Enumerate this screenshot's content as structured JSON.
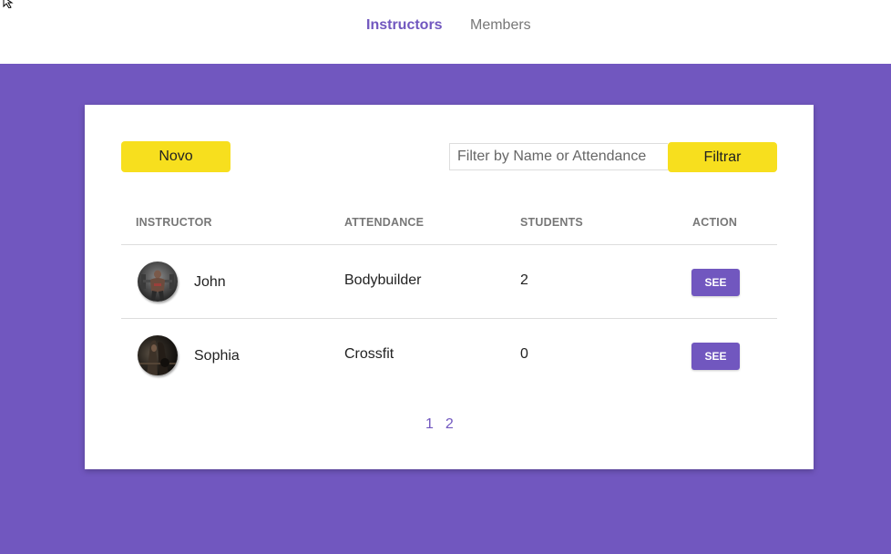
{
  "nav": {
    "instructors": "Instructors",
    "members": "Members"
  },
  "toolbar": {
    "new_label": "Novo",
    "search_placeholder": "Filter by Name or Attendance",
    "filter_label": "Filtrar"
  },
  "table": {
    "headers": [
      "INSTRUCTOR",
      "ATTENDANCE",
      "STUDENTS",
      "ACTION"
    ],
    "rows": [
      {
        "name": "John",
        "attendance": "Bodybuilder",
        "students": "2",
        "action": "SEE"
      },
      {
        "name": "Sophia",
        "attendance": "Crossfit",
        "students": "0",
        "action": "SEE"
      }
    ]
  },
  "pagination": {
    "pages": [
      "1",
      "2"
    ]
  },
  "colors": {
    "accent": "#7157bf",
    "button_yellow": "#f7df1e",
    "background": "#7157bf"
  },
  "icons": {
    "cursor": "mouse-pointer-icon"
  }
}
